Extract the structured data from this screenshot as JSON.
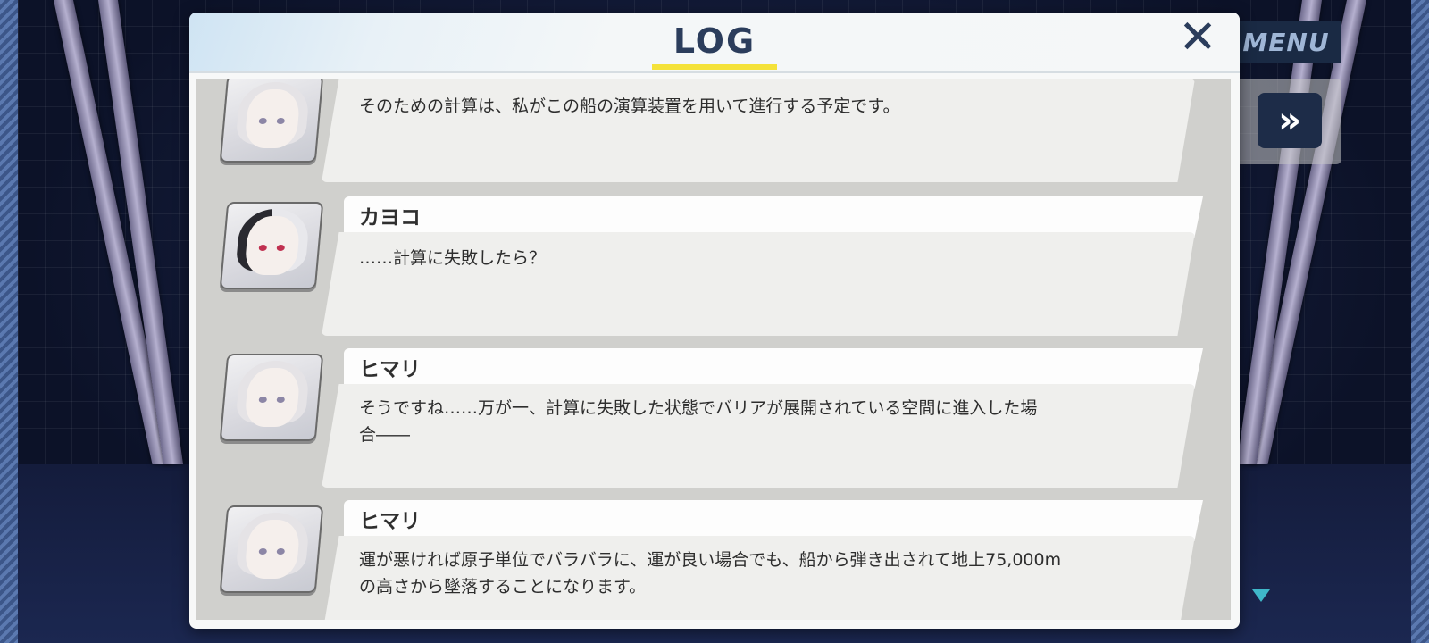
{
  "game_ui": {
    "menu_label": "MENU",
    "skip_label": "»"
  },
  "log_dialog": {
    "title": "LOG",
    "close_label": "✕",
    "accent_color": "#f4e23a",
    "entries": [
      {
        "speaker": "",
        "text": "そのための計算は、私がこの船の演算装置を用いて進行する予定です。"
      },
      {
        "speaker": "カヨコ",
        "text": "……計算に失敗したら？"
      },
      {
        "speaker": "ヒマリ",
        "text": "そうですね……万が一、計算に失敗した状態でバリアが展開されている空間に進入した場\n合――"
      },
      {
        "speaker": "ヒマリ",
        "text": "運が悪ければ原子単位でバラバラに、運が良い場合でも、船から弾き出されて地上75,000m\nの高さから墜落することになります。"
      }
    ]
  }
}
